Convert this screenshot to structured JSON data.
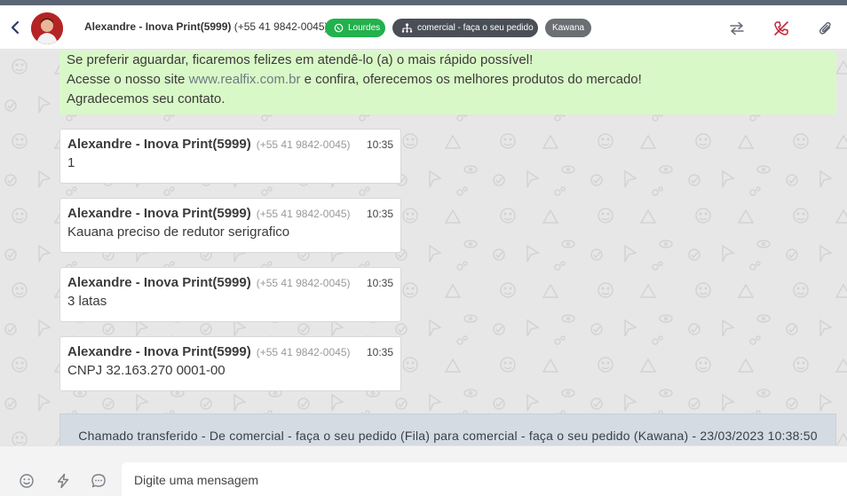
{
  "header": {
    "contact_name": "Alexandre - Inova Print(5999)",
    "contact_phone": "(+55 41 9842-0045)",
    "channel_chip": "Lourdes",
    "queue_chip": "comercial - faça o seu pedido",
    "agent_chip": "Kawana",
    "icons": [
      "back-icon",
      "avatar",
      "whatsapp-icon",
      "queue-icon",
      "transfer-icon",
      "hangup-icon",
      "attachment-icon"
    ]
  },
  "greeting": {
    "line1": "Se preferir aguardar, ficaremos felizes em atendê-lo (a) o mais rápido possível!",
    "line2_before": "Acesse o nosso site ",
    "line2_link": "www.realfix.com.br",
    "line2_after": " e confira, oferecemos os melhores produtos do mercado!",
    "line3": "Agradecemos seu contato."
  },
  "messages": [
    {
      "sender": "Alexandre - Inova Print(5999)",
      "phone": "(+55 41 9842-0045)",
      "time": "10:35",
      "text": "1"
    },
    {
      "sender": "Alexandre - Inova Print(5999)",
      "phone": "(+55 41 9842-0045)",
      "time": "10:35",
      "text": "Kauana preciso de redutor serigrafico"
    },
    {
      "sender": "Alexandre - Inova Print(5999)",
      "phone": "(+55 41 9842-0045)",
      "time": "10:35",
      "text": "3 latas"
    },
    {
      "sender": "Alexandre - Inova Print(5999)",
      "phone": "(+55 41 9842-0045)",
      "time": "10:35",
      "text": "CNPJ 32.163.270 0001-00"
    }
  ],
  "transfer_notice": "Chamado transferido - De comercial - faça o seu pedido (Fila) para comercial - faça o seu pedido (Kawana) - 23/03/2023 10:38:50",
  "composer": {
    "placeholder": "Digite uma mensagem",
    "value": "",
    "icons": [
      "emoji-icon",
      "quick-reply-icon",
      "chat-icon"
    ]
  },
  "colors": {
    "greeting_bg": "#d9f8c7",
    "whatsapp_chip": "#22b14c",
    "queue_chip": "#4a4f57",
    "agent_chip": "#6b6e73",
    "hangup_icon": "#c0283a",
    "transfer_bg": "#d4dbe2"
  }
}
